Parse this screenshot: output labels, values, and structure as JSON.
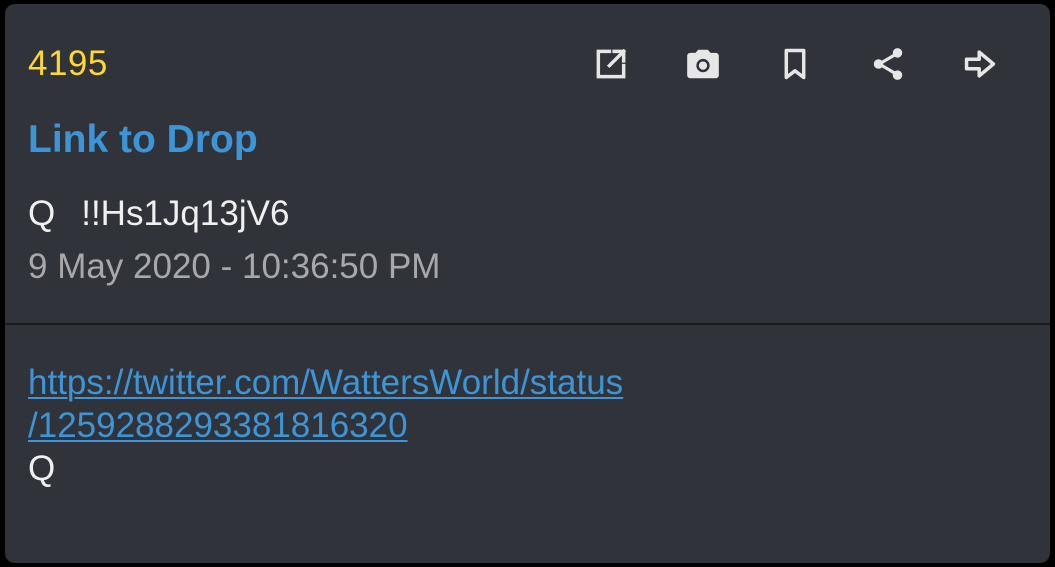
{
  "drop": {
    "number": "4195",
    "title_link": "Link to Drop",
    "author": "Q",
    "tripcode": "!!Hs1Jq13jV6",
    "timestamp": "9 May 2020 - 10:36:50 PM"
  },
  "toolbar": {
    "icons": [
      "open-external-icon",
      "camera-icon",
      "bookmark-icon",
      "share-icon",
      "forward-arrow-icon"
    ]
  },
  "post": {
    "link_line1": "https://twitter.com/WattersWorld/status",
    "link_line2": "/1259288293381816320",
    "signature": "Q"
  },
  "colors": {
    "card_background": "#31333a",
    "drop_number": "#ffd930",
    "link": "#3b95d6",
    "text": "#f0f0f0",
    "secondary_text": "#a8a8ac",
    "icon": "#e6e6e6"
  }
}
